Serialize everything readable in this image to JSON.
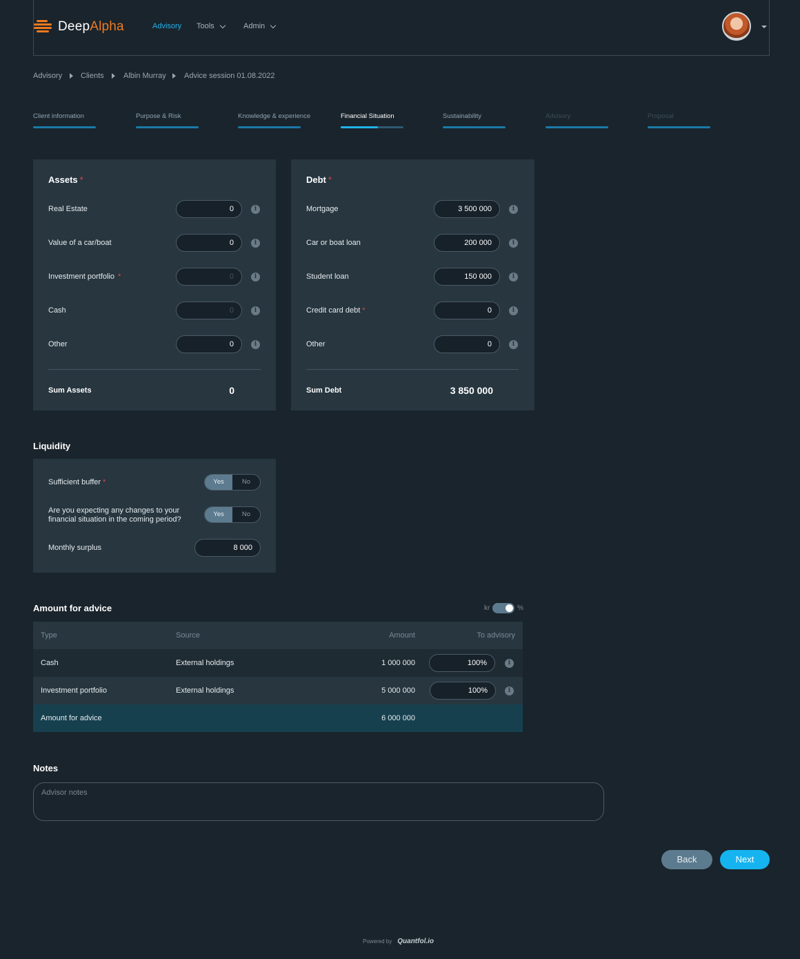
{
  "header": {
    "logo_main": "Deep",
    "logo_accent": "Alpha",
    "nav": [
      "Advisory",
      "Tools",
      "Admin"
    ]
  },
  "breadcrumb": [
    "Advisory",
    "Clients",
    "Albin Murray",
    "Advice session 01.08.2022"
  ],
  "steps": [
    "Client information",
    "Purpose & Risk",
    "Knowledge & experience",
    "Financial Situation",
    "Sustainability",
    "Advisory",
    "Proposal"
  ],
  "assets": {
    "title": "Assets",
    "rows": [
      {
        "label": "Real Estate",
        "value": "0"
      },
      {
        "label": "Value of a car/boat",
        "value": "0"
      },
      {
        "label": "Investment portfolio",
        "value": "0"
      },
      {
        "label": "Cash",
        "value": "0"
      },
      {
        "label": "Other",
        "value": "0"
      }
    ],
    "sum_label": "Sum Assets",
    "sum_value": "0"
  },
  "debt": {
    "title": "Debt",
    "rows": [
      {
        "label": "Mortgage",
        "value": "3 500 000"
      },
      {
        "label": "Car or boat loan",
        "value": "200 000"
      },
      {
        "label": "Student loan",
        "value": "150 000"
      },
      {
        "label": "Credit card debt",
        "value": "0"
      },
      {
        "label": "Other",
        "value": "0"
      }
    ],
    "sum_label": "Sum Debt",
    "sum_value": "3 850 000"
  },
  "liquidity": {
    "title": "Liquidity",
    "buffer_label": "Sufficient buffer",
    "changes_label_1": "Are you expecting any changes to your",
    "changes_label_2": "financial situation in the coming period?",
    "yes": "Yes",
    "no": "No",
    "surplus_label": "Monthly surplus",
    "surplus_value": "8 000"
  },
  "amount": {
    "title": "Amount for advice",
    "unit_left": "kr",
    "unit_right": "%",
    "headers": [
      "Type",
      "Source",
      "Amount",
      "To advisory"
    ],
    "rows": [
      {
        "type": "Cash",
        "source": "External holdings",
        "amount": "1 000 000",
        "to_advisory": "100%"
      },
      {
        "type": "Investment portfolio",
        "source": "External holdings",
        "amount": "5 000 000",
        "to_advisory": "100%"
      }
    ],
    "total_label": "Amount for advice",
    "total_value": "6 000 000"
  },
  "notes": {
    "title": "Notes",
    "placeholder": "Advisor notes"
  },
  "buttons": {
    "back": "Back",
    "next": "Next"
  },
  "footer": {
    "powered": "Powered by",
    "brand": "Quantfol.io"
  },
  "colors": {
    "accent": "#1fb3ea",
    "brand": "#f07a1e",
    "required": "#e0464e"
  }
}
